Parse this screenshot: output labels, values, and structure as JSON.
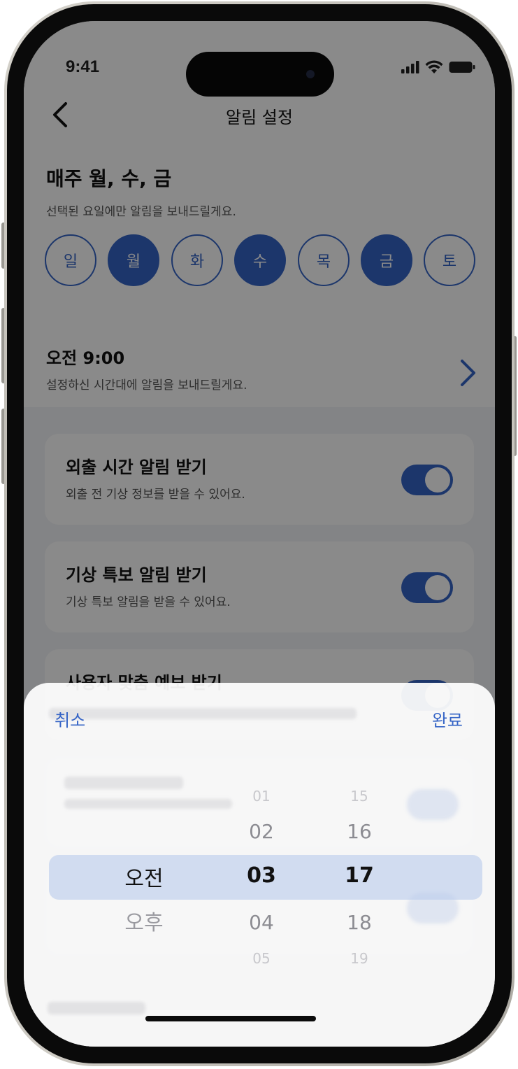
{
  "status_bar": {
    "time": "9:41"
  },
  "nav": {
    "title": "알림 설정"
  },
  "schedule": {
    "title": "매주 월, 수, 금",
    "subtitle": "선택된 요일에만 알림을 보내드릴게요.",
    "days": [
      {
        "label": "일",
        "selected": false
      },
      {
        "label": "월",
        "selected": true
      },
      {
        "label": "화",
        "selected": false
      },
      {
        "label": "수",
        "selected": true
      },
      {
        "label": "목",
        "selected": false
      },
      {
        "label": "금",
        "selected": true
      },
      {
        "label": "토",
        "selected": false
      }
    ]
  },
  "time_setting": {
    "value": "오전 9:00",
    "subtitle": "설정하신 시간대에 알림을 보내드릴게요."
  },
  "settings_cards": [
    {
      "title": "외출 시간 알림 받기",
      "subtitle": "외출 전 기상 정보를 받을 수 있어요.",
      "toggle_on": true
    },
    {
      "title": "기상 특보 알림 받기",
      "subtitle": "기상 특보 알림을 받을 수 있어요.",
      "toggle_on": true
    },
    {
      "title": "사용자 맞춤 예보 받기",
      "toggle_on": true
    }
  ],
  "picker_sheet": {
    "cancel_label": "취소",
    "done_label": "완료",
    "ampm": {
      "selected": "오전",
      "other": "오후"
    },
    "hours": [
      "01",
      "02",
      "03",
      "04",
      "05"
    ],
    "minutes": [
      "15",
      "16",
      "17",
      "18",
      "19"
    ],
    "selected_hour": "03",
    "selected_minute": "17"
  },
  "colors": {
    "accent": "#3564c6",
    "dim_overlay": "rgba(0,0,0,0.46)",
    "picker_highlight": "#b9cbeb"
  }
}
